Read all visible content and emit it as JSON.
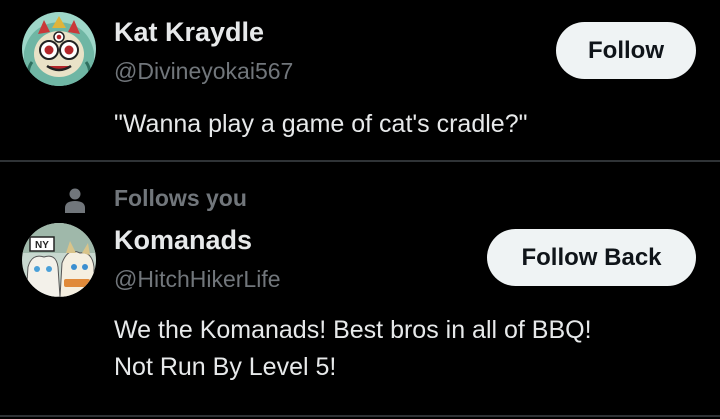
{
  "users": [
    {
      "display_name": "Kat Kraydle",
      "handle": "@Divineyokai567",
      "bio_lines": [
        "\"Wanna play a game of cat's cradle?\""
      ],
      "button_label": "Follow"
    },
    {
      "social_context": "Follows you",
      "display_name": "Komanads",
      "handle": "@HitchHikerLife",
      "bio_lines": [
        "We the Komanads! Best bros in all of BBQ!",
        "Not Run By Level 5!"
      ],
      "button_label": "Follow Back",
      "avatar_badge": "NY"
    }
  ],
  "colors": {
    "background": "#000000",
    "primary_text": "#e7e9ea",
    "secondary_text": "#71767b",
    "button_bg": "#eff3f4",
    "button_text": "#0f1419",
    "divider": "#2f3336"
  }
}
